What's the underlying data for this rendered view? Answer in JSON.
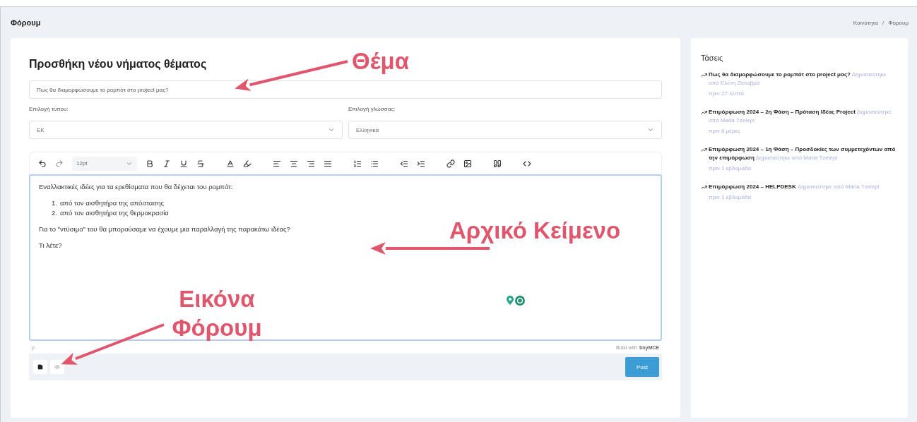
{
  "header": {
    "title": "Φόρουμ",
    "breadcrumb": [
      "Κοινότητα",
      "Φόρουμ"
    ],
    "separator": "/"
  },
  "form": {
    "heading": "Προσθήκη νέου νήματος θέματος",
    "subject": {
      "value": "Πως θα διαμορφώσουμε το ρομπότ στο project μας?"
    },
    "selects": [
      {
        "label": "Επιλογή τύπου:",
        "value": "ΕΚ"
      },
      {
        "label": "Επιλογή γλώσσας:",
        "value": "Ελληνικά"
      }
    ],
    "editor": {
      "font_size": "12pt",
      "content": [
        {
          "kind": "paragraph",
          "text": "Εναλλακτικές ιδέες για τα ερεθίσματα που θα δέχεται του ρομπότ:"
        },
        {
          "kind": "list",
          "items": [
            {
              "number": "1.",
              "text": "από τον αισθητήρα της απόστασης"
            },
            {
              "number": "2.",
              "text": "από τον αισθητήρα της θερμοκρασία"
            }
          ]
        },
        {
          "kind": "paragraph",
          "text": "Για το \"ντύσιμο\" του θα μπορούσαμε να έχουμε μια παραλλαγή της παρακάτω ιδέας?"
        },
        {
          "kind": "paragraph",
          "text": "Τι λέτε?"
        }
      ],
      "status_path": "p",
      "branding": "Build with",
      "brand": "tinyMCE"
    },
    "post_button": "Post"
  },
  "trends": {
    "title": "Τάσεις",
    "items": [
      {
        "title": "Πως θα διαμορφώσουμε το ρομπότ στο project μας?",
        "author": "Δημοσιεύτηκε από Ελένη Ζαλαβρά",
        "time": "πριν 27 λεπτά"
      },
      {
        "title": "Επιμόρφωση 2024 – 2η Φάση – Πρόταση Ιδέας Project",
        "author": "Δημοσιεύτηκε από Maria Tzelepi",
        "time": "πριν 6 μέρες"
      },
      {
        "title": "Επιμόρφωση 2024 – 1η Φάση – Προσδοκίες των συμμετεχόντων από την επιμόρφωση",
        "author": "Δημοσιεύτηκε από Maria Tzelepi",
        "time": "πριν 1 εβδομάδα"
      },
      {
        "title": "Επιμόρφωση 2024 – HELPDESK",
        "author": "Δημοσιεύτηκε από Maria Tzelepi",
        "time": "πριν 1 εβδομάδα"
      }
    ]
  },
  "annotations": [
    {
      "kind": "subject",
      "text": "Θέμα"
    },
    {
      "kind": "content",
      "text": "Αρχικό Κείμενο"
    },
    {
      "kind": "image",
      "text": "Εικόνα Φόρουμ"
    }
  ]
}
